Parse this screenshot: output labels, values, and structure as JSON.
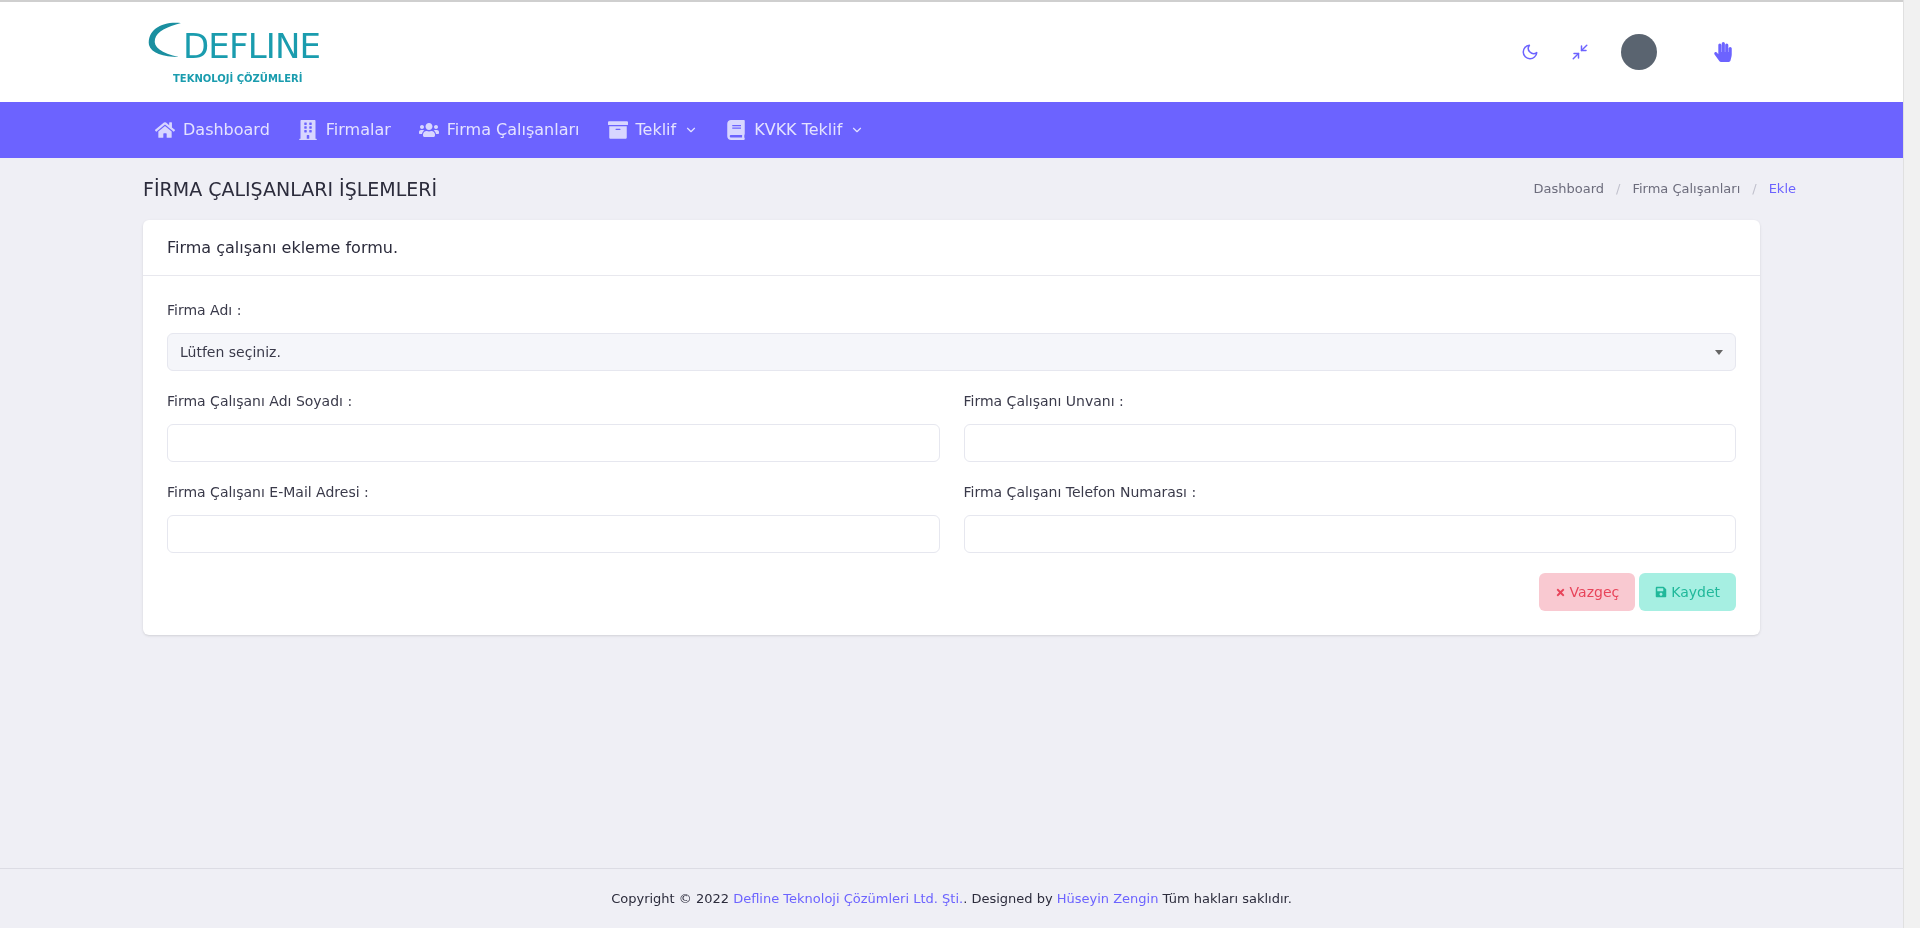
{
  "logo": {
    "name": "DEFLINE",
    "tagline": "TEKNOLOJİ ÇÖZÜMLERİ"
  },
  "nav": [
    {
      "label": "Dashboard",
      "dropdown": false
    },
    {
      "label": "Firmalar",
      "dropdown": false
    },
    {
      "label": "Firma Çalışanları",
      "dropdown": false
    },
    {
      "label": "Teklif",
      "dropdown": true
    },
    {
      "label": "KVKK Teklif",
      "dropdown": true
    }
  ],
  "page_title": "FİRMA ÇALIŞANLARI İŞLEMLERİ",
  "breadcrumb_separator": "/",
  "breadcrumb": [
    {
      "label": "Dashboard",
      "selected": false
    },
    {
      "label": "Firma Çalışanları",
      "selected": false
    },
    {
      "label": "Ekle",
      "selected": true
    }
  ],
  "card": {
    "title": "Firma çalışanı ekleme formu.",
    "fields": [
      {
        "kind": "select",
        "label": "Firma Adı :",
        "value": "Lütfen seçiniz."
      },
      {
        "kind": "text",
        "label": "Firma Çalışanı Adı Soyadı :"
      },
      {
        "kind": "text",
        "label": "Firma Çalışanı Unvanı :"
      },
      {
        "kind": "text",
        "label": "Firma Çalışanı E-Mail Adresi :"
      },
      {
        "kind": "text",
        "label": "Firma Çalışanı Telefon Numarası :"
      }
    ],
    "buttons": [
      {
        "kind": "cancel",
        "label": "Vazgeç"
      },
      {
        "kind": "save",
        "label": "Kaydet"
      }
    ]
  },
  "footer": [
    {
      "kind": "text",
      "text": "Copyright © 2022 "
    },
    {
      "kind": "link",
      "text": "Defline Teknoloji Çözümleri Ltd. Şti."
    },
    {
      "kind": "text",
      "text": ". Designed by "
    },
    {
      "kind": "link",
      "text": "Hüseyin Zengin"
    },
    {
      "kind": "text",
      "text": " Tüm hakları saklıdır."
    }
  ]
}
